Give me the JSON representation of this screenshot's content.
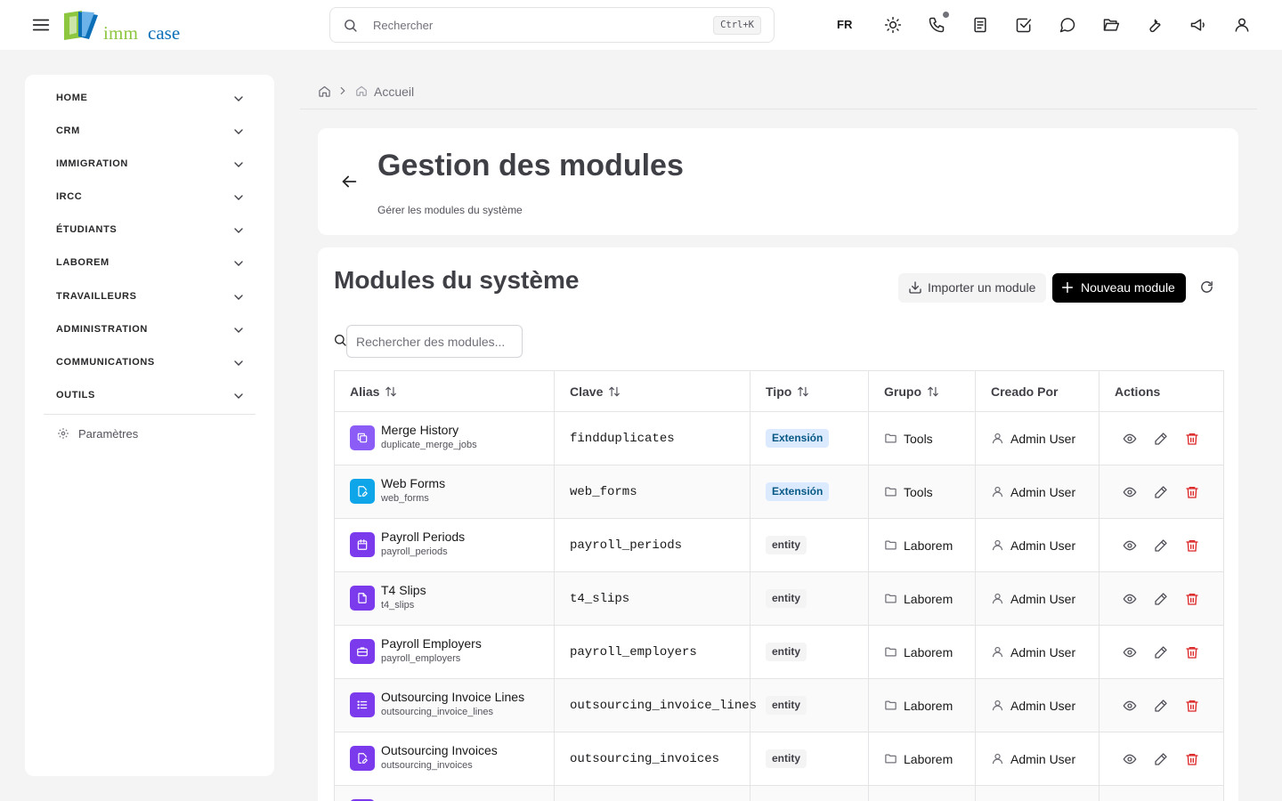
{
  "topbar": {
    "logo_word1": "imm",
    "logo_word2": "case",
    "search_placeholder": "Rechercher",
    "search_shortcut": "Ctrl+K",
    "lang": "FR"
  },
  "sidebar": {
    "items": [
      {
        "label": "HOME"
      },
      {
        "label": "CRM"
      },
      {
        "label": "IMMIGRATION"
      },
      {
        "label": "IRCC"
      },
      {
        "label": "ÉTUDIANTS"
      },
      {
        "label": "LABOREM"
      },
      {
        "label": "TRAVAILLEURS"
      },
      {
        "label": "ADMINISTRATION"
      },
      {
        "label": "COMMUNICATIONS"
      },
      {
        "label": "OUTILS"
      }
    ],
    "settings_label": "Paramètres"
  },
  "breadcrumb": {
    "current": "Accueil"
  },
  "header": {
    "title": "Gestion des modules",
    "subtitle": "Gérer les modules du système"
  },
  "modules": {
    "title": "Modules du système",
    "import_label": "Importer un module",
    "new_label": "Nouveau module",
    "search_placeholder": "Rechercher des modules...",
    "columns": [
      "Alias",
      "Clave",
      "Tipo",
      "Grupo",
      "Creado Por",
      "Actions"
    ],
    "rows": [
      {
        "name": "Merge History",
        "table": "duplicate_merge_jobs",
        "key": "findduplicates",
        "type": "Extensión",
        "group": "Tools",
        "creator": "Admin User",
        "icon": "copy-icon",
        "color": "#8b5cf6"
      },
      {
        "name": "Web Forms",
        "table": "web_forms",
        "key": "web_forms",
        "type": "Extensión",
        "group": "Tools",
        "creator": "Admin User",
        "icon": "file-edit-icon",
        "color": "#0ea5e9"
      },
      {
        "name": "Payroll Periods",
        "table": "payroll_periods",
        "key": "payroll_periods",
        "type": "entity",
        "group": "Laborem",
        "creator": "Admin User",
        "icon": "calendar-icon",
        "color": "#7c3aed"
      },
      {
        "name": "T4 Slips",
        "table": "t4_slips",
        "key": "t4_slips",
        "type": "entity",
        "group": "Laborem",
        "creator": "Admin User",
        "icon": "file-icon",
        "color": "#7c3aed"
      },
      {
        "name": "Payroll Employers",
        "table": "payroll_employers",
        "key": "payroll_employers",
        "type": "entity",
        "group": "Laborem",
        "creator": "Admin User",
        "icon": "briefcase-icon",
        "color": "#7c3aed"
      },
      {
        "name": "Outsourcing Invoice Lines",
        "table": "outsourcing_invoice_lines",
        "key": "outsourcing_invoice_lines",
        "type": "entity",
        "group": "Laborem",
        "creator": "Admin User",
        "icon": "list-icon",
        "color": "#7c3aed"
      },
      {
        "name": "Outsourcing Invoices",
        "table": "outsourcing_invoices",
        "key": "outsourcing_invoices",
        "type": "entity",
        "group": "Laborem",
        "creator": "Admin User",
        "icon": "file-edit-icon",
        "color": "#7c3aed"
      },
      {
        "name": "",
        "table": "",
        "key": "",
        "type": "",
        "group": "",
        "creator": "",
        "icon": "file-icon",
        "color": "#7c3aed"
      }
    ]
  },
  "colors": {
    "accent": "#000000",
    "extension_badge_bg": "#dbeafe",
    "extension_badge_text": "#075985",
    "delete": "#dc2626",
    "logo_green": "#8dc63f",
    "logo_blue": "#0b6fb8"
  }
}
